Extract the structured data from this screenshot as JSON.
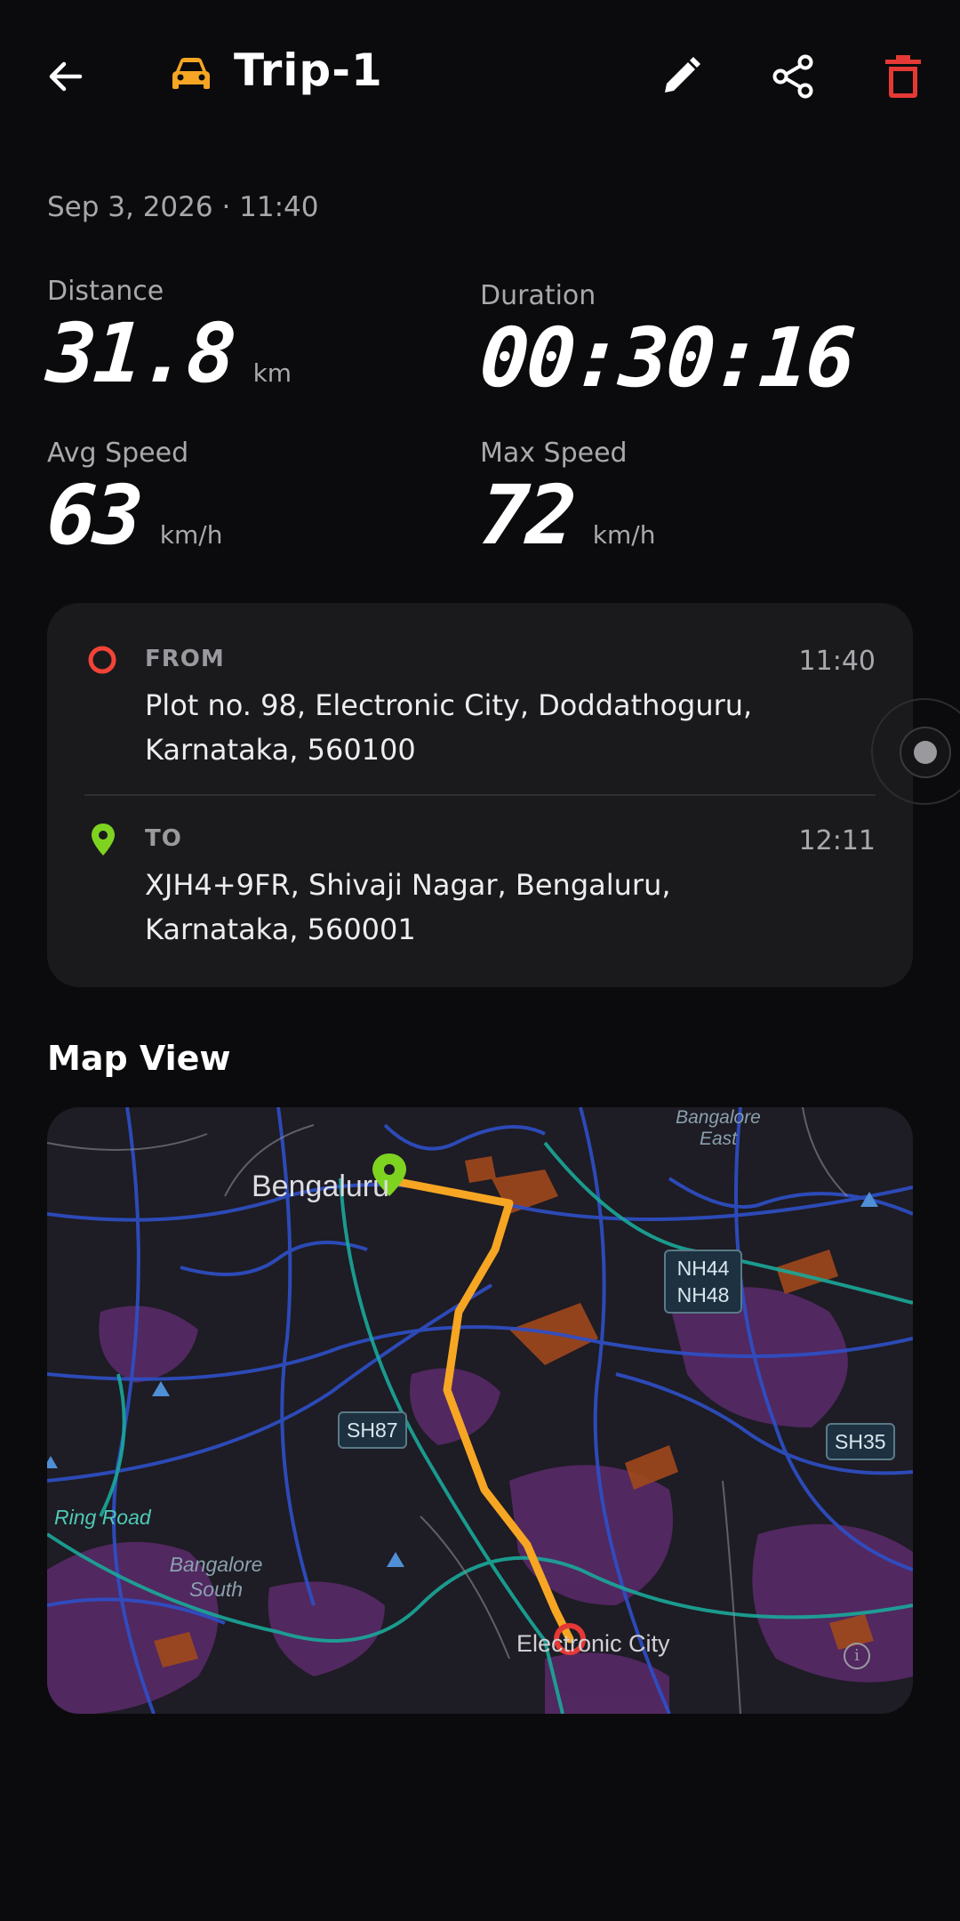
{
  "header": {
    "title": "Trip-1"
  },
  "trip": {
    "date": "Sep 3, 2026 · 11:40",
    "distance": {
      "label": "Distance",
      "value": "31.8",
      "unit": "km"
    },
    "duration": {
      "label": "Duration",
      "value": "00:30:16"
    },
    "avg_speed": {
      "label": "Avg Speed",
      "value": "63",
      "unit": "km/h"
    },
    "max_speed": {
      "label": "Max Speed",
      "value": "72",
      "unit": "km/h"
    }
  },
  "route": {
    "from": {
      "label": "FROM",
      "time": "11:40",
      "address": "Plot no. 98, Electronic City, Doddathoguru, Karnataka, 560100"
    },
    "to": {
      "label": "TO",
      "time": "12:11",
      "address": "XJH4+9FR, Shivaji Nagar, Bengaluru, Karnataka, 560001"
    }
  },
  "map_section": {
    "title": "Map View",
    "labels": {
      "city": "Bengaluru",
      "east": "Bangalore East",
      "south": "Bangalore South",
      "ring": "Ring Road",
      "electronic_city": "Electronic City"
    },
    "shields": {
      "nh": "NH44 NH48",
      "sh87": "SH87",
      "sh35": "SH35"
    }
  },
  "colors": {
    "accent": "#f6a623",
    "delete": "#e53935",
    "from_marker": "#f44336",
    "to_marker": "#7ed321"
  }
}
